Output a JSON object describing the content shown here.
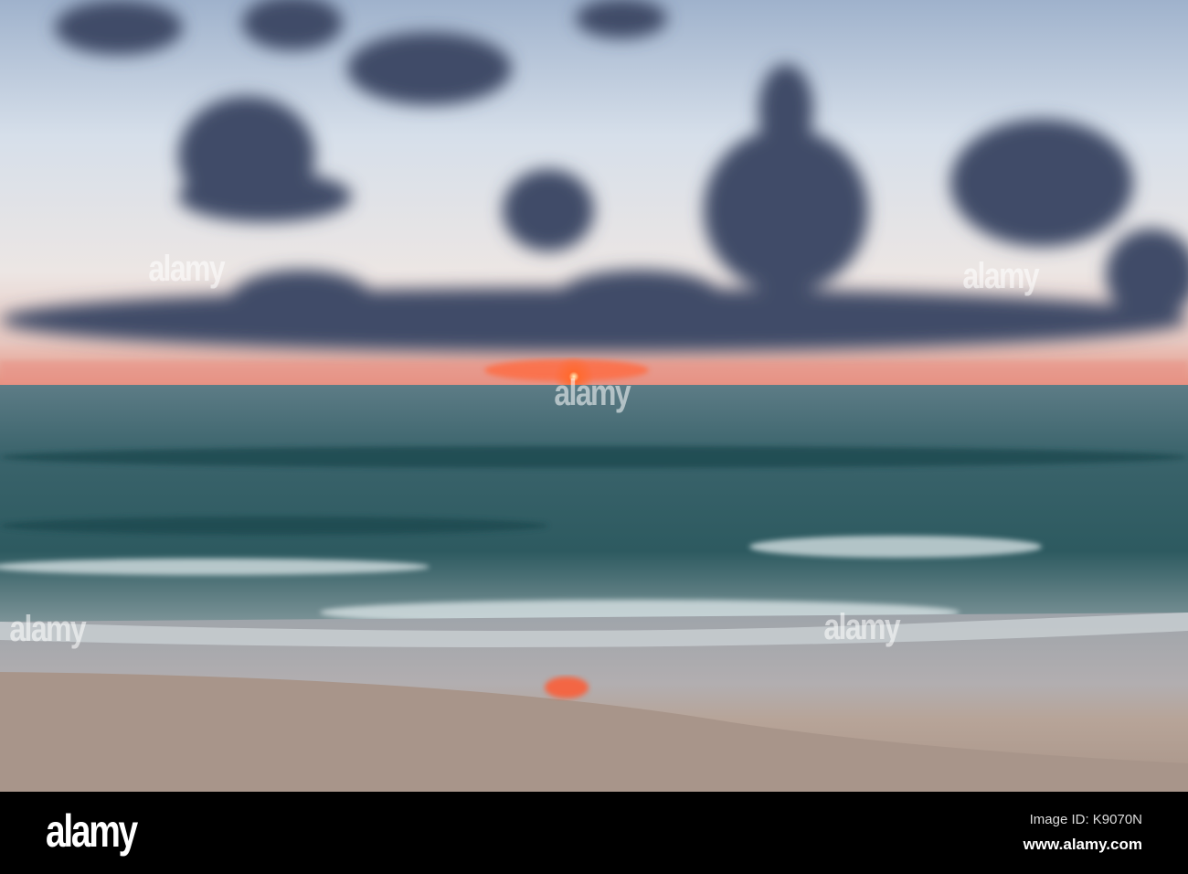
{
  "photo": {
    "subject": "sunrise-over-ocean-beach",
    "colors": {
      "sky_top": "#9fb2cc",
      "sky_mid": "#e6e8ee",
      "horizon": "#f07a5a",
      "sun": "#ff5a2a",
      "sea": "#2f5a62",
      "sand": "#b8a89e",
      "cloud": "#3d4a66"
    }
  },
  "watermark": {
    "text": "alamy"
  },
  "footer": {
    "logo": "alamy",
    "image_id": "Image ID: K9070N",
    "website": "www.alamy.com"
  }
}
